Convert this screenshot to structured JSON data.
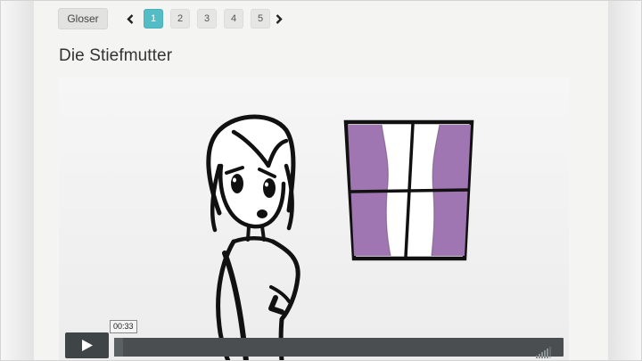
{
  "toolbar": {
    "gloser_label": "Gloser",
    "pages": [
      "1",
      "2",
      "3",
      "4",
      "5"
    ],
    "active_page": 1
  },
  "lesson": {
    "title": "Die Stiefmutter"
  },
  "video": {
    "current_time": "00:33",
    "progress_fraction": 0.02,
    "volume_level": 0.8
  },
  "colors": {
    "accent": "#53bcc5",
    "curtain": "#a076b2",
    "player_bar": "#3f4447"
  },
  "icons": {
    "prev": "chevron-left-icon",
    "next": "chevron-right-icon",
    "play": "play-icon",
    "volume": "volume-bars-icon"
  }
}
